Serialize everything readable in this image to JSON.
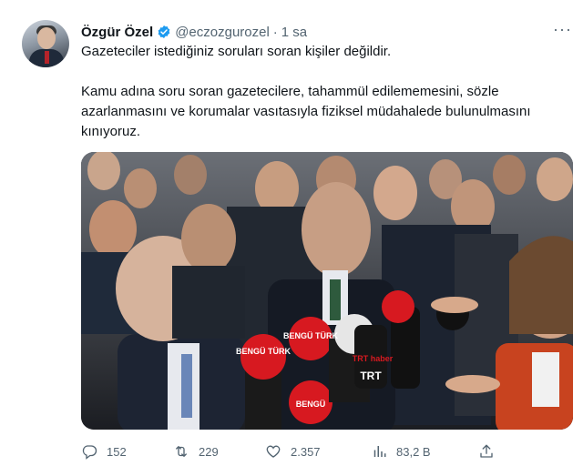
{
  "tweet": {
    "author_name": "Özgür Özel",
    "handle": "@eczozgurozel",
    "separator": "·",
    "time": "1 sa",
    "more": "···",
    "paragraph1": "Gazeteciler istediğiniz soruları soran kişiler değildir.",
    "paragraph2": "Kamu adına soru soran gazetecilere, tahammül edilememesini, sözle azarlanmasını ve korumalar vasıtasıyla fiziksel müdahalede bulunulmasını kınıyoruz.",
    "photo": {
      "mic_labels": [
        "BENGÜ TÜRK",
        "TRT haber",
        "BENGÜ TÜRK",
        "TRT",
        "BENGÜ"
      ]
    },
    "stats": {
      "replies": "152",
      "retweets": "229",
      "likes": "2.357",
      "views": "83,2 B"
    }
  },
  "colors": {
    "verified_blue": "#1d9bf0",
    "muted_text": "#536471",
    "mic_red": "#d71920"
  },
  "icons": [
    "verified-badge-icon",
    "more-icon",
    "reply-icon",
    "retweet-icon",
    "like-icon",
    "views-icon",
    "share-icon"
  ]
}
